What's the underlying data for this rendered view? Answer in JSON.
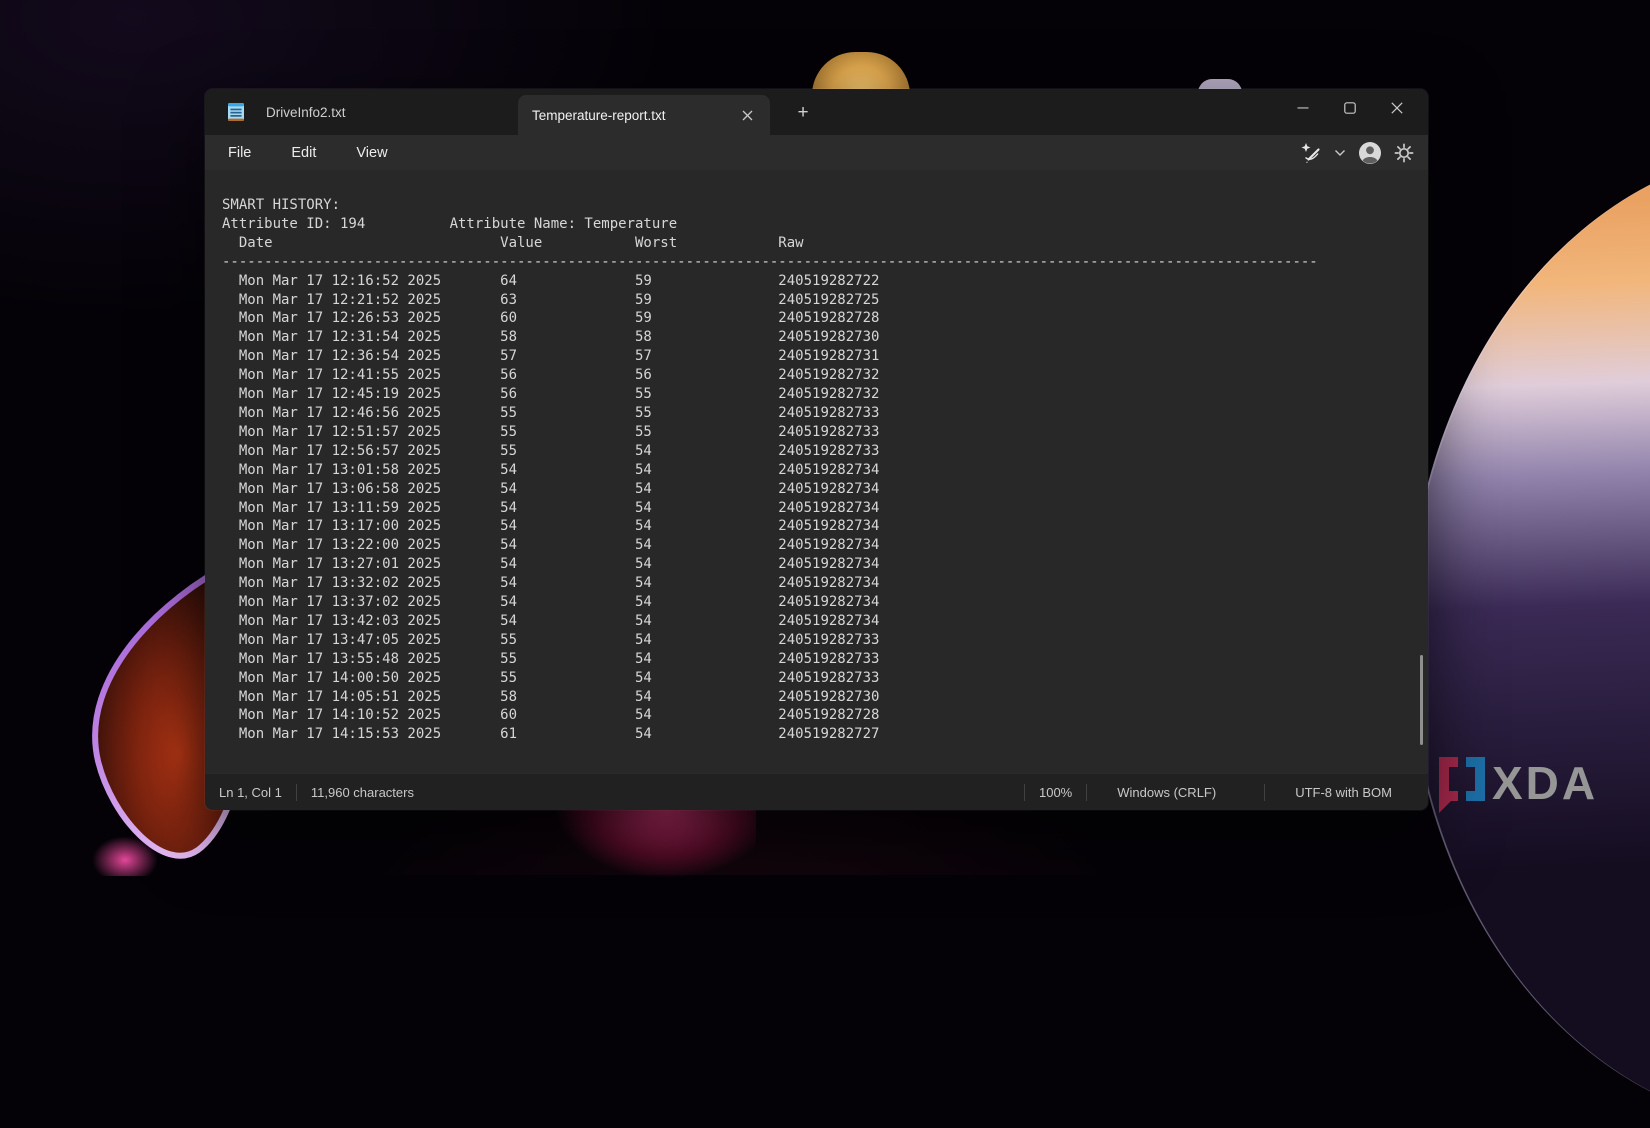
{
  "window": {
    "tab_bar": {
      "tabs": [
        {
          "label": "DriveInfo2.txt",
          "active": false
        },
        {
          "label": "Temperature-report.txt",
          "active": true
        }
      ],
      "new_tab_label": "+",
      "icons": [
        "notepad-icon",
        "close-icon",
        "plus-icon"
      ]
    },
    "window_controls": {
      "minimize": "minimize",
      "maximize": "maximize",
      "close": "close"
    },
    "menu_bar": {
      "items": [
        {
          "label": "File"
        },
        {
          "label": "Edit"
        },
        {
          "label": "View"
        }
      ],
      "right_icons": [
        "rewrite-ai-pen-icon",
        "chevron-down-icon",
        "account-icon",
        "gear-icon"
      ]
    },
    "status_bar": {
      "cursor_position": "Ln 1, Col 1",
      "character_count": "11,960 characters",
      "zoom": "100%",
      "line_ending": "Windows (CRLF)",
      "encoding": "UTF-8 with BOM"
    }
  },
  "editor": {
    "title_line": "SMART HISTORY:",
    "attribute_id_label": "Attribute ID: 194",
    "attribute_name_label": "Attribute Name: Temperature",
    "columns": [
      "Date",
      "Value",
      "Worst",
      "Raw"
    ],
    "divider_dash_count": 130,
    "rows": [
      [
        "Mon Mar 17 12:16:52 2025",
        "64",
        "59",
        "240519282722"
      ],
      [
        "Mon Mar 17 12:21:52 2025",
        "63",
        "59",
        "240519282725"
      ],
      [
        "Mon Mar 17 12:26:53 2025",
        "60",
        "59",
        "240519282728"
      ],
      [
        "Mon Mar 17 12:31:54 2025",
        "58",
        "58",
        "240519282730"
      ],
      [
        "Mon Mar 17 12:36:54 2025",
        "57",
        "57",
        "240519282731"
      ],
      [
        "Mon Mar 17 12:41:55 2025",
        "56",
        "56",
        "240519282732"
      ],
      [
        "Mon Mar 17 12:45:19 2025",
        "56",
        "55",
        "240519282732"
      ],
      [
        "Mon Mar 17 12:46:56 2025",
        "55",
        "55",
        "240519282733"
      ],
      [
        "Mon Mar 17 12:51:57 2025",
        "55",
        "55",
        "240519282733"
      ],
      [
        "Mon Mar 17 12:56:57 2025",
        "55",
        "54",
        "240519282733"
      ],
      [
        "Mon Mar 17 13:01:58 2025",
        "54",
        "54",
        "240519282734"
      ],
      [
        "Mon Mar 17 13:06:58 2025",
        "54",
        "54",
        "240519282734"
      ],
      [
        "Mon Mar 17 13:11:59 2025",
        "54",
        "54",
        "240519282734"
      ],
      [
        "Mon Mar 17 13:17:00 2025",
        "54",
        "54",
        "240519282734"
      ],
      [
        "Mon Mar 17 13:22:00 2025",
        "54",
        "54",
        "240519282734"
      ],
      [
        "Mon Mar 17 13:27:01 2025",
        "54",
        "54",
        "240519282734"
      ],
      [
        "Mon Mar 17 13:32:02 2025",
        "54",
        "54",
        "240519282734"
      ],
      [
        "Mon Mar 17 13:37:02 2025",
        "54",
        "54",
        "240519282734"
      ],
      [
        "Mon Mar 17 13:42:03 2025",
        "54",
        "54",
        "240519282734"
      ],
      [
        "Mon Mar 17 13:47:05 2025",
        "55",
        "54",
        "240519282733"
      ],
      [
        "Mon Mar 17 13:55:48 2025",
        "55",
        "54",
        "240519282733"
      ],
      [
        "Mon Mar 17 14:00:50 2025",
        "55",
        "54",
        "240519282733"
      ],
      [
        "Mon Mar 17 14:05:51 2025",
        "58",
        "54",
        "240519282730"
      ],
      [
        "Mon Mar 17 14:10:52 2025",
        "60",
        "54",
        "240519282728"
      ],
      [
        "Mon Mar 17 14:15:53 2025",
        "61",
        "54",
        "240519282727"
      ]
    ]
  },
  "branding": {
    "logo_text": "XDA"
  },
  "colors": {
    "tab_bar_bg": "#1c1c1c",
    "chrome_bg": "#2c2c2c",
    "editor_bg": "#282828",
    "status_bg": "#212121",
    "editor_text": "#d6d6d6",
    "xda_red": "#a8294d",
    "xda_blue": "#1d6fa8",
    "xda_gray": "#969696"
  }
}
